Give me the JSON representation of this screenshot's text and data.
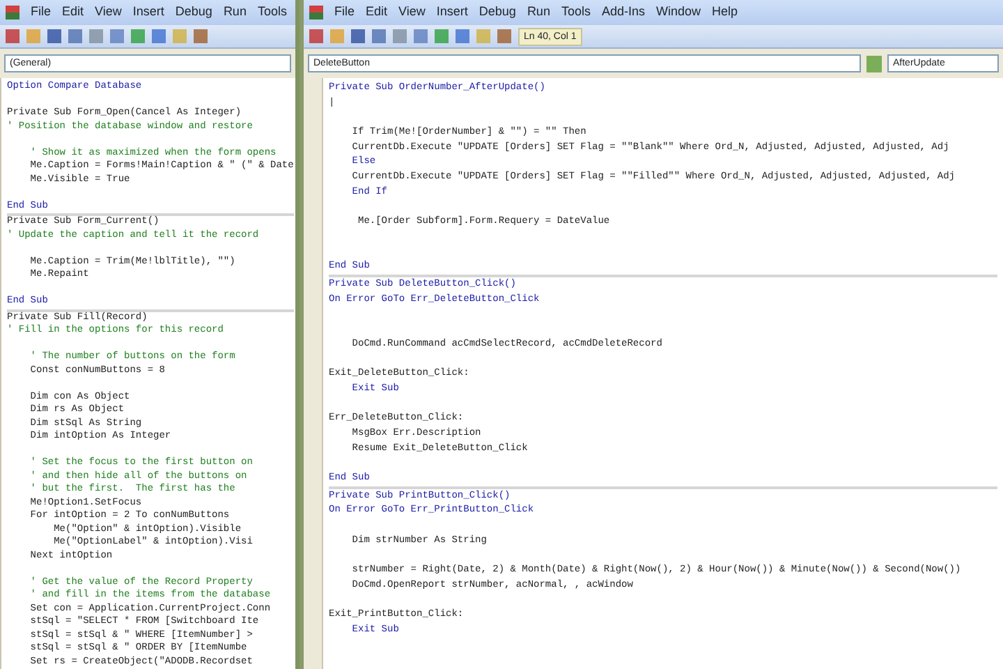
{
  "left_window": {
    "menu": [
      "File",
      "Edit",
      "View",
      "Insert",
      "Debug",
      "Run",
      "Tools"
    ],
    "procedure_combo": "(General)",
    "code_lines": [
      {
        "kind": "keyword",
        "text": "Option Compare Database"
      },
      {
        "kind": "blank"
      },
      {
        "kind": "code",
        "text": "Private Sub Form_Open(Cancel As Integer)"
      },
      {
        "kind": "comment",
        "text": "' Position the database window and restore"
      },
      {
        "kind": "blank"
      },
      {
        "kind": "comment",
        "text": "    ' Show it as maximized when the form opens"
      },
      {
        "kind": "code",
        "text": "    Me.Caption = Forms!Main!Caption & \" (\" & Date"
      },
      {
        "kind": "code",
        "text": "    Me.Visible = True"
      },
      {
        "kind": "blank"
      },
      {
        "kind": "keyword",
        "text": "End Sub"
      },
      {
        "kind": "divider"
      },
      {
        "kind": "code",
        "text": "Private Sub Form_Current()"
      },
      {
        "kind": "comment",
        "text": "' Update the caption and tell it the record"
      },
      {
        "kind": "blank"
      },
      {
        "kind": "code",
        "text": "    Me.Caption = Trim(Me!lblTitle), \"\")"
      },
      {
        "kind": "code",
        "text": "    Me.Repaint"
      },
      {
        "kind": "blank"
      },
      {
        "kind": "keyword",
        "text": "End Sub"
      },
      {
        "kind": "divider"
      },
      {
        "kind": "code",
        "text": "Private Sub Fill(Record)"
      },
      {
        "kind": "comment",
        "text": "' Fill in the options for this record"
      },
      {
        "kind": "blank"
      },
      {
        "kind": "comment",
        "text": "    ' The number of buttons on the form"
      },
      {
        "kind": "code",
        "text": "    Const conNumButtons = 8"
      },
      {
        "kind": "blank"
      },
      {
        "kind": "code",
        "text": "    Dim con As Object"
      },
      {
        "kind": "code",
        "text": "    Dim rs As Object"
      },
      {
        "kind": "code",
        "text": "    Dim stSql As String"
      },
      {
        "kind": "code",
        "text": "    Dim intOption As Integer"
      },
      {
        "kind": "blank"
      },
      {
        "kind": "comment",
        "text": "    ' Set the focus to the first button on"
      },
      {
        "kind": "comment",
        "text": "    ' and then hide all of the buttons on"
      },
      {
        "kind": "comment",
        "text": "    ' but the first.  The first has the"
      },
      {
        "kind": "code",
        "text": "    Me!Option1.SetFocus"
      },
      {
        "kind": "code",
        "text": "    For intOption = 2 To conNumButtons"
      },
      {
        "kind": "code",
        "text": "        Me(\"Option\" & intOption).Visible"
      },
      {
        "kind": "code",
        "text": "        Me(\"OptionLabel\" & intOption).Visi"
      },
      {
        "kind": "code",
        "text": "    Next intOption"
      },
      {
        "kind": "blank"
      },
      {
        "kind": "comment",
        "text": "    ' Get the value of the Record Property"
      },
      {
        "kind": "comment",
        "text": "    ' and fill in the items from the database"
      },
      {
        "kind": "code",
        "text": "    Set con = Application.CurrentProject.Conn"
      },
      {
        "kind": "code",
        "text": "    stSql = \"SELECT * FROM [Switchboard Ite"
      },
      {
        "kind": "code",
        "text": "    stSql = stSql & \" WHERE [ItemNumber] >"
      },
      {
        "kind": "code",
        "text": "    stSql = stSql & \" ORDER BY [ItemNumbe"
      },
      {
        "kind": "code",
        "text": "    Set rs = CreateObject(\"ADODB.Recordset"
      }
    ]
  },
  "right_window": {
    "menu": [
      "File",
      "Edit",
      "View",
      "Insert",
      "Debug",
      "Run",
      "Tools",
      "Add-Ins",
      "Window",
      "Help"
    ],
    "toolbar_position": "Ln 40, Col 1",
    "object_combo": "DeleteButton",
    "procedure_combo": "AfterUpdate",
    "code_lines": [
      {
        "kind": "keyword",
        "text": "Private Sub OrderNumber_AfterUpdate()"
      },
      {
        "kind": "code",
        "text": "|"
      },
      {
        "kind": "blank"
      },
      {
        "kind": "code",
        "text": "    If Trim(Me![OrderNumber] & \"\") = \"\" Then"
      },
      {
        "kind": "code",
        "text": "    CurrentDb.Execute \"UPDATE [Orders] SET Flag = \"\"Blank\"\" Where Ord_N, Adjusted, Adjusted, Adjusted, Adj"
      },
      {
        "kind": "keyword",
        "text": "    Else"
      },
      {
        "kind": "code",
        "text": "    CurrentDb.Execute \"UPDATE [Orders] SET Flag = \"\"Filled\"\" Where Ord_N, Adjusted, Adjusted, Adjusted, Adj"
      },
      {
        "kind": "keyword",
        "text": "    End If"
      },
      {
        "kind": "blank"
      },
      {
        "kind": "code",
        "text": "     Me.[Order Subform].Form.Requery = DateValue"
      },
      {
        "kind": "blank"
      },
      {
        "kind": "blank"
      },
      {
        "kind": "keyword",
        "text": "End Sub"
      },
      {
        "kind": "divider"
      },
      {
        "kind": "keyword",
        "text": "Private Sub DeleteButton_Click()"
      },
      {
        "kind": "keyword",
        "text": "On Error GoTo Err_DeleteButton_Click"
      },
      {
        "kind": "blank"
      },
      {
        "kind": "blank"
      },
      {
        "kind": "code",
        "text": "    DoCmd.RunCommand acCmdSelectRecord, acCmdDeleteRecord"
      },
      {
        "kind": "blank"
      },
      {
        "kind": "code",
        "text": "Exit_DeleteButton_Click:"
      },
      {
        "kind": "keyword",
        "text": "    Exit Sub"
      },
      {
        "kind": "blank"
      },
      {
        "kind": "code",
        "text": "Err_DeleteButton_Click:"
      },
      {
        "kind": "code",
        "text": "    MsgBox Err.Description"
      },
      {
        "kind": "code",
        "text": "    Resume Exit_DeleteButton_Click"
      },
      {
        "kind": "blank"
      },
      {
        "kind": "keyword",
        "text": "End Sub"
      },
      {
        "kind": "divider"
      },
      {
        "kind": "keyword",
        "text": "Private Sub PrintButton_Click()"
      },
      {
        "kind": "keyword",
        "text": "On Error GoTo Err_PrintButton_Click"
      },
      {
        "kind": "blank"
      },
      {
        "kind": "code",
        "text": "    Dim strNumber As String"
      },
      {
        "kind": "blank"
      },
      {
        "kind": "code",
        "text": "    strNumber = Right(Date, 2) & Month(Date) & Right(Now(), 2) & Hour(Now()) & Minute(Now()) & Second(Now())"
      },
      {
        "kind": "code",
        "text": "    DoCmd.OpenReport strNumber, acNormal, , acWindow"
      },
      {
        "kind": "blank"
      },
      {
        "kind": "code",
        "text": "Exit_PrintButton_Click:"
      },
      {
        "kind": "keyword",
        "text": "    Exit Sub"
      }
    ]
  }
}
